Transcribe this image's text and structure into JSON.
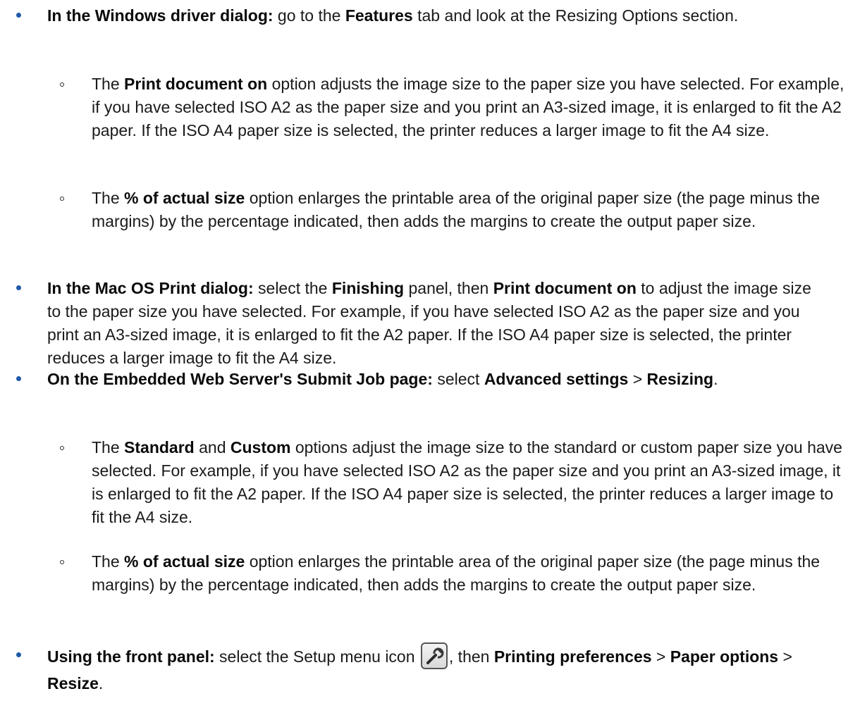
{
  "items": [
    {
      "level": 1,
      "lead": "In the Windows driver dialog:",
      "t1": " go to the ",
      "b1": "Features",
      "t2": " tab and look at the Resizing Options section."
    },
    {
      "level": 2,
      "t0": "The ",
      "b1": "Print document on",
      "t1": " option adjusts the image size to the paper size you have selected. For example, if you have selected ISO A2 as the paper size and you print an A3-sized image, it is enlarged to fit the A2 paper. If the ISO A4 paper size is selected, the printer reduces a larger image to fit the A4 size."
    },
    {
      "level": 2,
      "t0": "The ",
      "b1": "% of actual size",
      "t1": " option enlarges the printable area of the original paper size (the page minus the margins) by the percentage indicated, then adds the margins to create the output paper size."
    },
    {
      "level": 1,
      "lead": "In the Mac OS Print dialog:",
      "t1": " select the ",
      "b1": "Finishing",
      "t2": " panel, then ",
      "b2": "Print document on",
      "t3": " to adjust the image size to the paper size you have selected. For example, if you have selected ISO A2 as the paper size and you print an A3-sized image, it is enlarged to fit the A2 paper. If the ISO A4 paper size is selected, the printer reduces a larger image to fit the A4 size."
    },
    {
      "level": 1,
      "lead": "On the Embedded Web Server's Submit Job page:",
      "t1": " select ",
      "b1": "Advanced settings",
      "t2": " > ",
      "b2": "Resizing",
      "t3": "."
    },
    {
      "level": 2,
      "t0": "The ",
      "b1": "Standard",
      "t1": " and ",
      "b2": "Custom",
      "t2": " options adjust the image size to the standard or custom paper size you have selected. For example, if you have selected ISO A2 as the paper size and you print an A3-sized image, it is enlarged to fit the A2 paper. If the ISO A4 paper size is selected, the printer reduces a larger image to fit the A4 size."
    },
    {
      "level": 2,
      "t0": "The ",
      "b1": "% of actual size",
      "t1": " option enlarges the printable area of the original paper size (the page minus the margins) by the percentage indicated, then adds the margins to create the output paper size."
    },
    {
      "level": 1,
      "lead": "Using the front panel:",
      "t1": " select the Setup menu icon ",
      "icon": "wrench-setup-icon",
      "t2": ", then ",
      "b1": "Printing preferences",
      "t3": " > ",
      "b2": "Paper options",
      "t4": " > ",
      "b3": "Resize",
      "t5": "."
    }
  ],
  "colors": {
    "bullet": "#1f59a8",
    "text": "#1a1a1a"
  }
}
